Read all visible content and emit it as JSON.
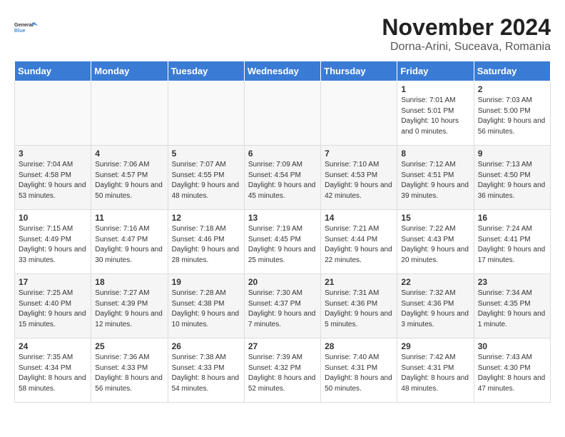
{
  "logo": {
    "line1": "General",
    "line2": "Blue"
  },
  "title": "November 2024",
  "subtitle": "Dorna-Arini, Suceava, Romania",
  "weekdays": [
    "Sunday",
    "Monday",
    "Tuesday",
    "Wednesday",
    "Thursday",
    "Friday",
    "Saturday"
  ],
  "weeks": [
    [
      {
        "day": "",
        "info": ""
      },
      {
        "day": "",
        "info": ""
      },
      {
        "day": "",
        "info": ""
      },
      {
        "day": "",
        "info": ""
      },
      {
        "day": "",
        "info": ""
      },
      {
        "day": "1",
        "info": "Sunrise: 7:01 AM\nSunset: 5:01 PM\nDaylight: 10 hours and 0 minutes."
      },
      {
        "day": "2",
        "info": "Sunrise: 7:03 AM\nSunset: 5:00 PM\nDaylight: 9 hours and 56 minutes."
      }
    ],
    [
      {
        "day": "3",
        "info": "Sunrise: 7:04 AM\nSunset: 4:58 PM\nDaylight: 9 hours and 53 minutes."
      },
      {
        "day": "4",
        "info": "Sunrise: 7:06 AM\nSunset: 4:57 PM\nDaylight: 9 hours and 50 minutes."
      },
      {
        "day": "5",
        "info": "Sunrise: 7:07 AM\nSunset: 4:55 PM\nDaylight: 9 hours and 48 minutes."
      },
      {
        "day": "6",
        "info": "Sunrise: 7:09 AM\nSunset: 4:54 PM\nDaylight: 9 hours and 45 minutes."
      },
      {
        "day": "7",
        "info": "Sunrise: 7:10 AM\nSunset: 4:53 PM\nDaylight: 9 hours and 42 minutes."
      },
      {
        "day": "8",
        "info": "Sunrise: 7:12 AM\nSunset: 4:51 PM\nDaylight: 9 hours and 39 minutes."
      },
      {
        "day": "9",
        "info": "Sunrise: 7:13 AM\nSunset: 4:50 PM\nDaylight: 9 hours and 36 minutes."
      }
    ],
    [
      {
        "day": "10",
        "info": "Sunrise: 7:15 AM\nSunset: 4:49 PM\nDaylight: 9 hours and 33 minutes."
      },
      {
        "day": "11",
        "info": "Sunrise: 7:16 AM\nSunset: 4:47 PM\nDaylight: 9 hours and 30 minutes."
      },
      {
        "day": "12",
        "info": "Sunrise: 7:18 AM\nSunset: 4:46 PM\nDaylight: 9 hours and 28 minutes."
      },
      {
        "day": "13",
        "info": "Sunrise: 7:19 AM\nSunset: 4:45 PM\nDaylight: 9 hours and 25 minutes."
      },
      {
        "day": "14",
        "info": "Sunrise: 7:21 AM\nSunset: 4:44 PM\nDaylight: 9 hours and 22 minutes."
      },
      {
        "day": "15",
        "info": "Sunrise: 7:22 AM\nSunset: 4:43 PM\nDaylight: 9 hours and 20 minutes."
      },
      {
        "day": "16",
        "info": "Sunrise: 7:24 AM\nSunset: 4:41 PM\nDaylight: 9 hours and 17 minutes."
      }
    ],
    [
      {
        "day": "17",
        "info": "Sunrise: 7:25 AM\nSunset: 4:40 PM\nDaylight: 9 hours and 15 minutes."
      },
      {
        "day": "18",
        "info": "Sunrise: 7:27 AM\nSunset: 4:39 PM\nDaylight: 9 hours and 12 minutes."
      },
      {
        "day": "19",
        "info": "Sunrise: 7:28 AM\nSunset: 4:38 PM\nDaylight: 9 hours and 10 minutes."
      },
      {
        "day": "20",
        "info": "Sunrise: 7:30 AM\nSunset: 4:37 PM\nDaylight: 9 hours and 7 minutes."
      },
      {
        "day": "21",
        "info": "Sunrise: 7:31 AM\nSunset: 4:36 PM\nDaylight: 9 hours and 5 minutes."
      },
      {
        "day": "22",
        "info": "Sunrise: 7:32 AM\nSunset: 4:36 PM\nDaylight: 9 hours and 3 minutes."
      },
      {
        "day": "23",
        "info": "Sunrise: 7:34 AM\nSunset: 4:35 PM\nDaylight: 9 hours and 1 minute."
      }
    ],
    [
      {
        "day": "24",
        "info": "Sunrise: 7:35 AM\nSunset: 4:34 PM\nDaylight: 8 hours and 58 minutes."
      },
      {
        "day": "25",
        "info": "Sunrise: 7:36 AM\nSunset: 4:33 PM\nDaylight: 8 hours and 56 minutes."
      },
      {
        "day": "26",
        "info": "Sunrise: 7:38 AM\nSunset: 4:33 PM\nDaylight: 8 hours and 54 minutes."
      },
      {
        "day": "27",
        "info": "Sunrise: 7:39 AM\nSunset: 4:32 PM\nDaylight: 8 hours and 52 minutes."
      },
      {
        "day": "28",
        "info": "Sunrise: 7:40 AM\nSunset: 4:31 PM\nDaylight: 8 hours and 50 minutes."
      },
      {
        "day": "29",
        "info": "Sunrise: 7:42 AM\nSunset: 4:31 PM\nDaylight: 8 hours and 48 minutes."
      },
      {
        "day": "30",
        "info": "Sunrise: 7:43 AM\nSunset: 4:30 PM\nDaylight: 8 hours and 47 minutes."
      }
    ]
  ]
}
